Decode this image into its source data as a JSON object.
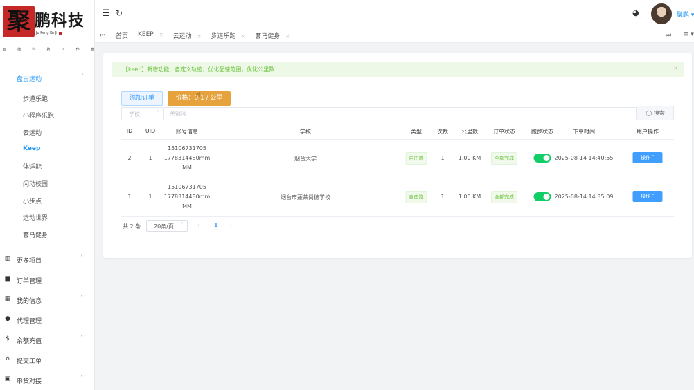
{
  "brand": {
    "mark": "聚",
    "name": "鹏科技",
    "english": "Ju Peng Ke Ji",
    "slogan": [
      "智",
      "能",
      "科",
      "技",
      "工",
      "作",
      "室"
    ]
  },
  "sidebar": {
    "group": {
      "label": "盘古运动",
      "chevron": "˄"
    },
    "sub_items": [
      {
        "label": "步道乐跑",
        "active": false
      },
      {
        "label": "小程序乐跑",
        "active": false
      },
      {
        "label": "云运动",
        "active": false
      },
      {
        "label": "Keep",
        "active": true
      },
      {
        "label": "体适能",
        "active": false
      },
      {
        "label": "闪动校园",
        "active": false
      },
      {
        "label": "小步点",
        "active": false
      },
      {
        "label": "运动世界",
        "active": false
      },
      {
        "label": "套马健身",
        "active": false
      }
    ],
    "top_items": [
      {
        "label": "更多项目",
        "icon": "▥",
        "chevron": "˅"
      },
      {
        "label": "订单管理",
        "icon": "▆",
        "chevron": ""
      },
      {
        "label": "我的信息",
        "icon": "▦",
        "chevron": "˅"
      },
      {
        "label": "代理管理",
        "icon": "●",
        "chevron": ""
      },
      {
        "label": "余额充值",
        "icon": "$",
        "chevron": "˅"
      },
      {
        "label": "提交工单",
        "icon": "∩",
        "chevron": ""
      },
      {
        "label": "串货对接",
        "icon": "▣",
        "chevron": "˅"
      }
    ]
  },
  "header": {
    "menu_icon": "☰",
    "refresh_icon": "↻",
    "palette_icon": "◕",
    "username": "聚鹏 ▾"
  },
  "tabbar": {
    "first_icon": "⏮",
    "last_icon": "⏭",
    "more_icon": "≡ ▾",
    "close_icon": "×",
    "tabs": [
      "首页",
      "KEEP",
      "云运动",
      "步道乐跑",
      "套马健身"
    ]
  },
  "alert": {
    "text": "【keep】新增功能：自定义轨迹，优化配速范围，优化公里数",
    "close": "×"
  },
  "toolbar": {
    "add_label": "添加订单",
    "price_label": "价格：0.1 / 公里",
    "cursor": "☝",
    "select_value": "学校",
    "select_chevron": "˅",
    "search_placeholder": "关键词",
    "search_label": "◯ 搜索"
  },
  "table": {
    "headers": [
      "ID",
      "UID",
      "账号信息",
      "学校",
      "类型",
      "次数",
      "公里数",
      "订单状态",
      "跑步状态",
      "下单时间",
      "用户操作"
    ],
    "rows": [
      {
        "id": "2",
        "uid": "1",
        "account": [
          "15106731705",
          "1778314480mm",
          "MM"
        ],
        "school": "烟台大学",
        "type": "自由跑",
        "count": "1",
        "km": "1.00 KM",
        "status": "全部完成",
        "running": true,
        "time": "2025-08-14 14:40:55",
        "op": "操作 ˅"
      },
      {
        "id": "1",
        "uid": "1",
        "account": [
          "15106731705",
          "1778314480mm",
          "MM"
        ],
        "school": "烟台市蓬莱尚德学校",
        "type": "自由跑",
        "count": "1",
        "km": "1.00 KM",
        "status": "全部完成",
        "running": true,
        "time": "2025-08-14 14:35:09",
        "op": "操作 ˅"
      }
    ]
  },
  "pagination": {
    "total": "共 2 条",
    "page_size": "20条/页",
    "page_size_chevron": "˅",
    "prev": "‹",
    "current": "1",
    "next": "›"
  },
  "colors": {
    "primary": "#409eff",
    "warning": "#e6a23c",
    "success": "#67c23a",
    "switch_on": "#13ce66",
    "brand_red": "#c62828"
  }
}
